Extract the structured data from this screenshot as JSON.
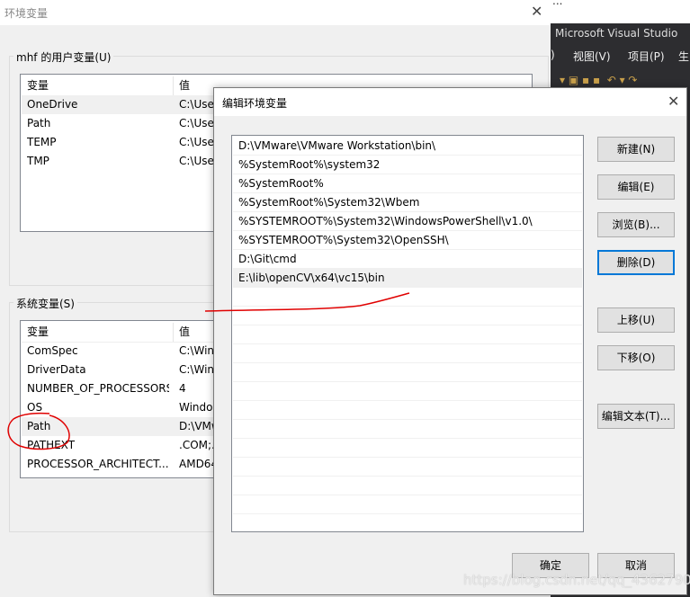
{
  "bg_window": {
    "title": "环境变量",
    "user_group": "mhf 的用户变量(U)",
    "system_group": "系统变量(S)",
    "col_var": "变量",
    "col_val": "值",
    "user_vars": [
      {
        "name": "OneDrive",
        "value": "C:\\User"
      },
      {
        "name": "Path",
        "value": "C:\\User"
      },
      {
        "name": "TEMP",
        "value": "C:\\User"
      },
      {
        "name": "TMP",
        "value": "C:\\User"
      }
    ],
    "system_vars": [
      {
        "name": "ComSpec",
        "value": "C:\\Wind"
      },
      {
        "name": "DriverData",
        "value": "C:\\Wind"
      },
      {
        "name": "NUMBER_OF_PROCESSORS",
        "value": "4"
      },
      {
        "name": "OS",
        "value": "Window"
      },
      {
        "name": "Path",
        "value": "D:\\VMw"
      },
      {
        "name": "PATHEXT",
        "value": ".COM;.E"
      },
      {
        "name": "PROCESSOR_ARCHITECT...",
        "value": "AMD64"
      }
    ]
  },
  "vs": {
    "top_text": "...",
    "title": "Microsoft Visual Studio",
    "menu": [
      ")",
      "视图(V)",
      "项目(P)",
      "生"
    ]
  },
  "edit_dialog": {
    "title": "编辑环境变量",
    "entries": [
      "D:\\VMware\\VMware Workstation\\bin\\",
      "%SystemRoot%\\system32",
      "%SystemRoot%",
      "%SystemRoot%\\System32\\Wbem",
      "%SYSTEMROOT%\\System32\\WindowsPowerShell\\v1.0\\",
      "%SYSTEMROOT%\\System32\\OpenSSH\\",
      "D:\\Git\\cmd",
      "E:\\lib\\openCV\\x64\\vc15\\bin"
    ],
    "buttons": {
      "new": "新建(N)",
      "edit": "编辑(E)",
      "browse": "浏览(B)...",
      "delete": "删除(D)",
      "up": "上移(U)",
      "down": "下移(O)",
      "edit_text": "编辑文本(T)...",
      "ok": "确定",
      "cancel": "取消"
    }
  },
  "watermark": "https://blog.csdn.net/qq_43627907",
  "annotation_color": "#e00000"
}
